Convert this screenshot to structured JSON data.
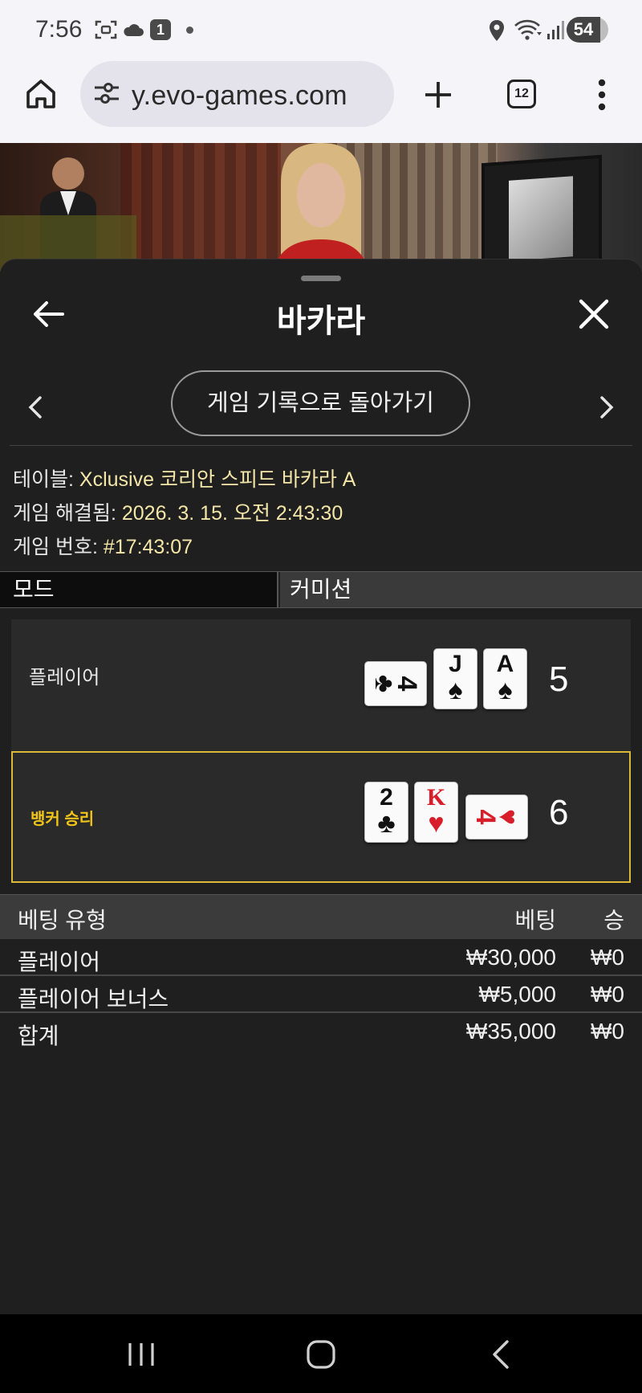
{
  "status_bar": {
    "time": "7:56",
    "notification_count": "1",
    "battery": "54",
    "icons": [
      "screenshot-icon",
      "cloud-icon",
      "location-icon",
      "wifi-icon",
      "signal-icon"
    ]
  },
  "browser": {
    "url": "y.evo-games.com",
    "tab_count": "12",
    "icons": [
      "home-icon",
      "site-settings-icon",
      "new-tab-plus-icon",
      "tabs-icon",
      "more-vert-icon"
    ]
  },
  "modal": {
    "title": "바카라",
    "back_to_history_label": "게임 기록으로 돌아가기",
    "info": {
      "table_label": "테이블:",
      "table_value": "Xclusive 코리안 스피드 바카라 A",
      "resolved_label": "게임 해결됨:",
      "resolved_value": "2026. 3. 15. 오전 2:43:30",
      "game_no_label": "게임 번호:",
      "game_no_value": "#17:43:07"
    },
    "mode_label": "모드",
    "mode_value": "커미션",
    "hands": {
      "player": {
        "label": "플레이어",
        "score": "5",
        "cards": [
          {
            "rank": "4",
            "suit": "♣",
            "color": "black",
            "sideways": true
          },
          {
            "rank": "J",
            "suit": "♠",
            "color": "black",
            "sideways": false
          },
          {
            "rank": "A",
            "suit": "♠",
            "color": "black",
            "sideways": false
          }
        ]
      },
      "banker": {
        "label": "뱅커 승리",
        "score": "6",
        "cards": [
          {
            "rank": "2",
            "suit": "♣",
            "color": "black",
            "sideways": false
          },
          {
            "rank": "K",
            "suit": "♥",
            "color": "red",
            "sideways": false
          },
          {
            "rank": "4",
            "suit": "♥",
            "color": "red",
            "sideways": true
          }
        ]
      }
    },
    "bets": {
      "headers": {
        "type": "베팅 유형",
        "bet": "베팅",
        "win": "승"
      },
      "rows": [
        {
          "type": "플레이어",
          "bet": "₩30,000",
          "win": "₩0"
        },
        {
          "type": "플레이어 보너스",
          "bet": "₩5,000",
          "win": "₩0"
        }
      ],
      "total": {
        "type": "합계",
        "bet": "₩35,000",
        "win": "₩0"
      }
    }
  },
  "colors": {
    "winner_accent": "#f0c419",
    "info_value": "#f3e6a8",
    "panel_bg": "#1f1f1f"
  }
}
